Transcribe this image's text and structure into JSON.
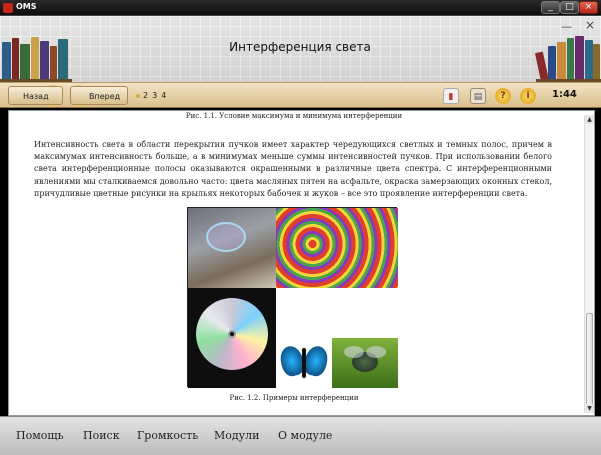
{
  "window": {
    "app_title": "OMS",
    "min_label": "_",
    "max_label": "□",
    "close_label": "×"
  },
  "header": {
    "title": "Интерференция света",
    "inner_min": "—",
    "inner_close": "×"
  },
  "toolbar": {
    "back_label": "Назад",
    "forward_label": "Вперед",
    "pages": [
      "2",
      "3",
      "4"
    ],
    "timer": "1:44",
    "icons": [
      "bookmark-icon",
      "print-icon",
      "help-icon",
      "info-icon"
    ]
  },
  "content": {
    "top_caption": "Рис. 1.1. Условие максимума и минимума интерференции",
    "paragraph": "Интенсивность света в области перекрытия пучков имеет характер чередующихся светлых и темных полос, причем в максимумах интенсивность больше, а в минимумах меньше суммы интенсивностей пучков. При использовании белого света интерференционные полосы оказываются окрашенными в различные цвета спектра. С интерференционными явлениями мы сталкиваемся довольно часто: цвета масляных пятен на асфальте, окраска замерзающих оконных стекол, причудливые цветные рисунки на крыльях некоторых бабочек и жуков – все это проявление интерференции света.",
    "figure_caption": "Рис. 1.2. Примеры интерференции"
  },
  "bottom_menu": {
    "items": [
      "Помощь",
      "Поиск",
      "Громкость",
      "Модули",
      "О модуле"
    ]
  }
}
